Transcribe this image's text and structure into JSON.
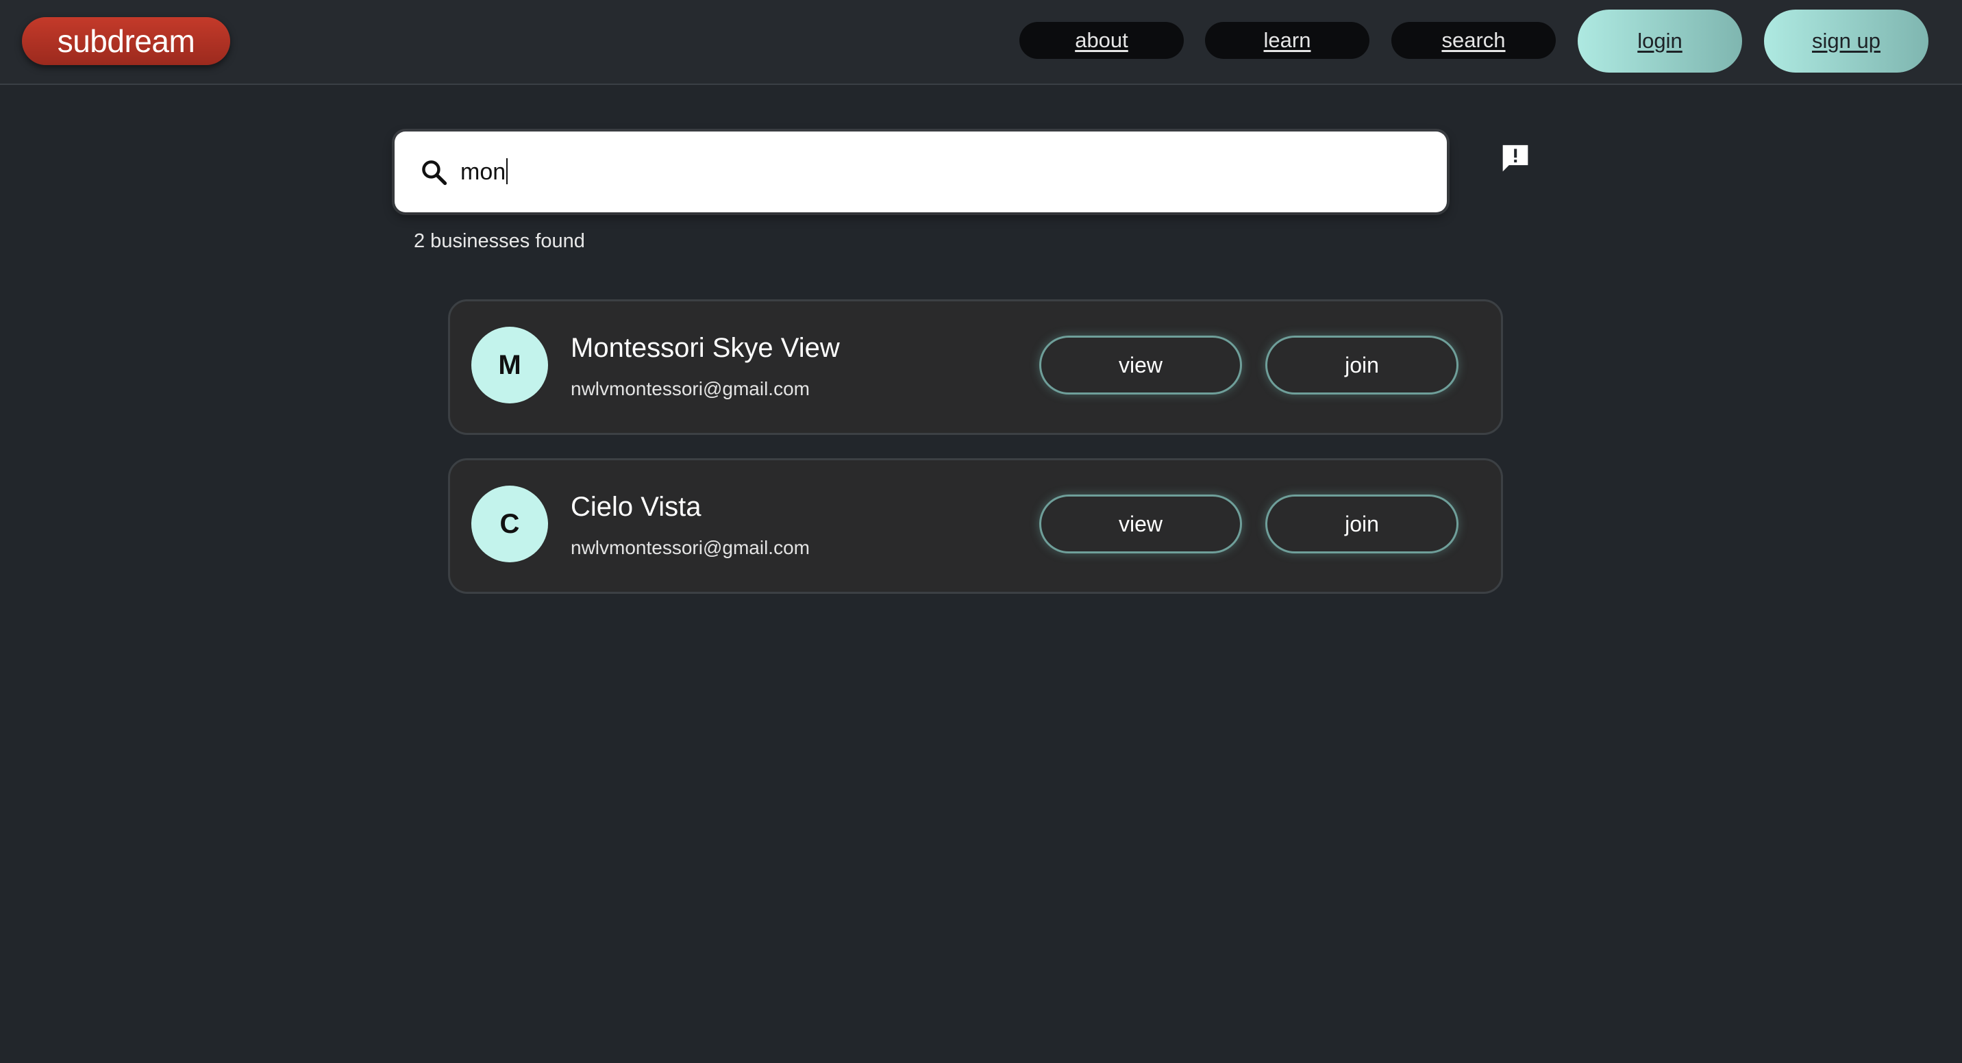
{
  "header": {
    "logo": "subdream",
    "nav": [
      "about",
      "learn",
      "search"
    ],
    "login_label": "login",
    "signup_label": "sign up"
  },
  "search": {
    "value": "mon",
    "result_count": "2 businesses found"
  },
  "results": [
    {
      "initial": "M",
      "name": "Montessori Skye View",
      "email": "nwlvmontessori@gmail.com",
      "view_label": "view",
      "join_label": "join"
    },
    {
      "initial": "C",
      "name": "Cielo Vista",
      "email": "nwlvmontessori@gmail.com",
      "view_label": "view",
      "join_label": "join"
    }
  ],
  "icons": {
    "search": "search-icon",
    "feedback": "feedback-icon"
  },
  "colors": {
    "background": "#22262b",
    "logo": "#b83324",
    "accent": "#aee9e1",
    "avatar": "#c3f3ec"
  }
}
